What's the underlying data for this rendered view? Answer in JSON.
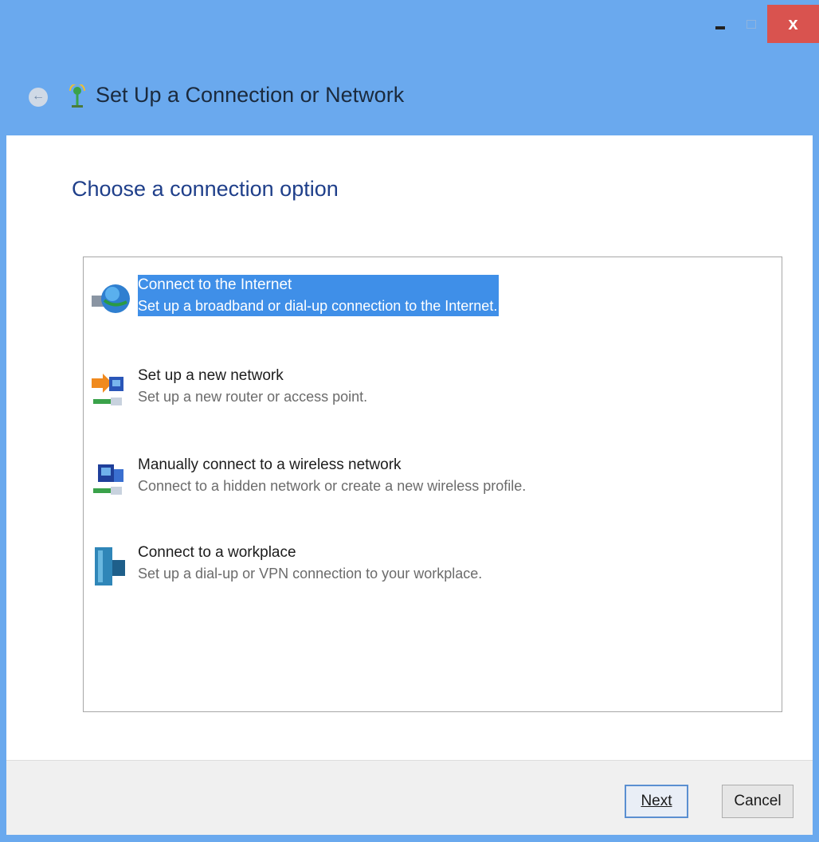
{
  "window": {
    "title": "Set Up a Connection or Network",
    "close_glyph": "x"
  },
  "page": {
    "heading": "Choose a connection option"
  },
  "options": [
    {
      "title": "Connect to the Internet",
      "description": "Set up a broadband or dial-up connection to the Internet.",
      "icon": "globe-icon",
      "selected": true
    },
    {
      "title": "Set up a new network",
      "description": "Set up a new router or access point.",
      "icon": "new-network-icon",
      "selected": false
    },
    {
      "title": "Manually connect to a wireless network",
      "description": "Connect to a hidden network or create a new wireless profile.",
      "icon": "wireless-network-icon",
      "selected": false
    },
    {
      "title": "Connect to a workplace",
      "description": "Set up a dial-up or VPN connection to your workplace.",
      "icon": "workplace-icon",
      "selected": false
    }
  ],
  "footer": {
    "next_label": "Next",
    "cancel_label": "Cancel"
  },
  "colors": {
    "titlebar": "#6aa9ee",
    "selection": "#3f8fe8",
    "heading": "#1f3f8a",
    "close_button": "#d9534f"
  }
}
